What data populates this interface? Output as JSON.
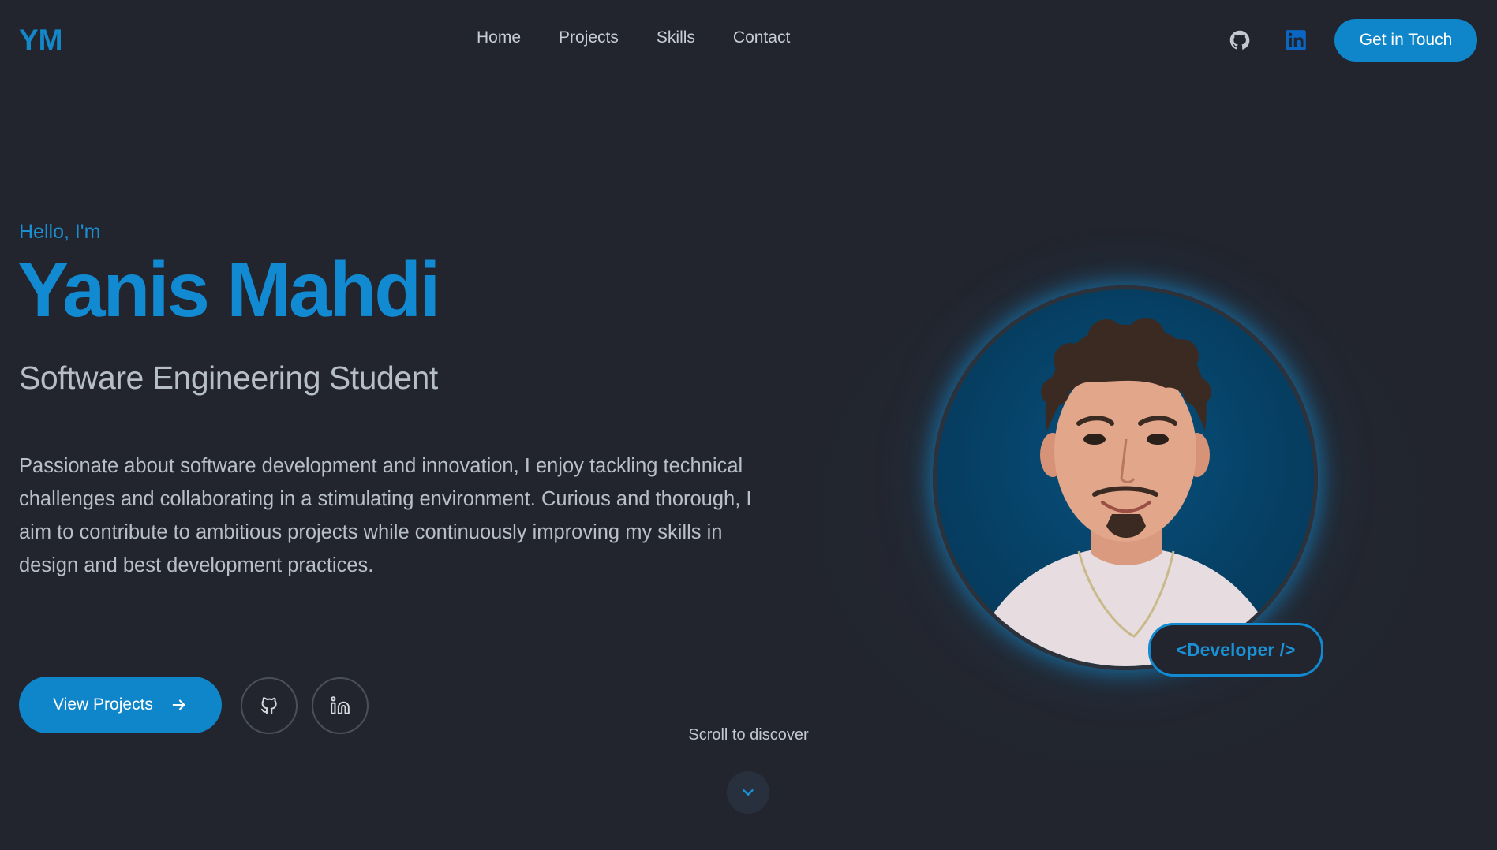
{
  "brand": {
    "logo": "YM"
  },
  "nav": {
    "items": [
      {
        "label": "Home"
      },
      {
        "label": "Projects"
      },
      {
        "label": "Skills"
      },
      {
        "label": "Contact"
      }
    ],
    "icons": [
      "github-icon",
      "linkedin-icon"
    ],
    "cta_label": "Get in Touch"
  },
  "hero": {
    "greeting": "Hello, I'm",
    "name": "Yanis Mahdi",
    "role": "Software Engineering Student",
    "description": "Passionate about software development and innovation, I enjoy tackling technical challenges and collaborating in a stimulating environment. Curious and thorough, I aim to contribute to ambitious projects while continuously improving my skills in design and best development practices.",
    "view_projects_label": "View Projects",
    "badge": "<Developer />"
  },
  "scroll": {
    "label": "Scroll to discover"
  },
  "colors": {
    "background": "#22252e",
    "accent": "#0e86c9",
    "text_muted": "#b9bfc9"
  }
}
